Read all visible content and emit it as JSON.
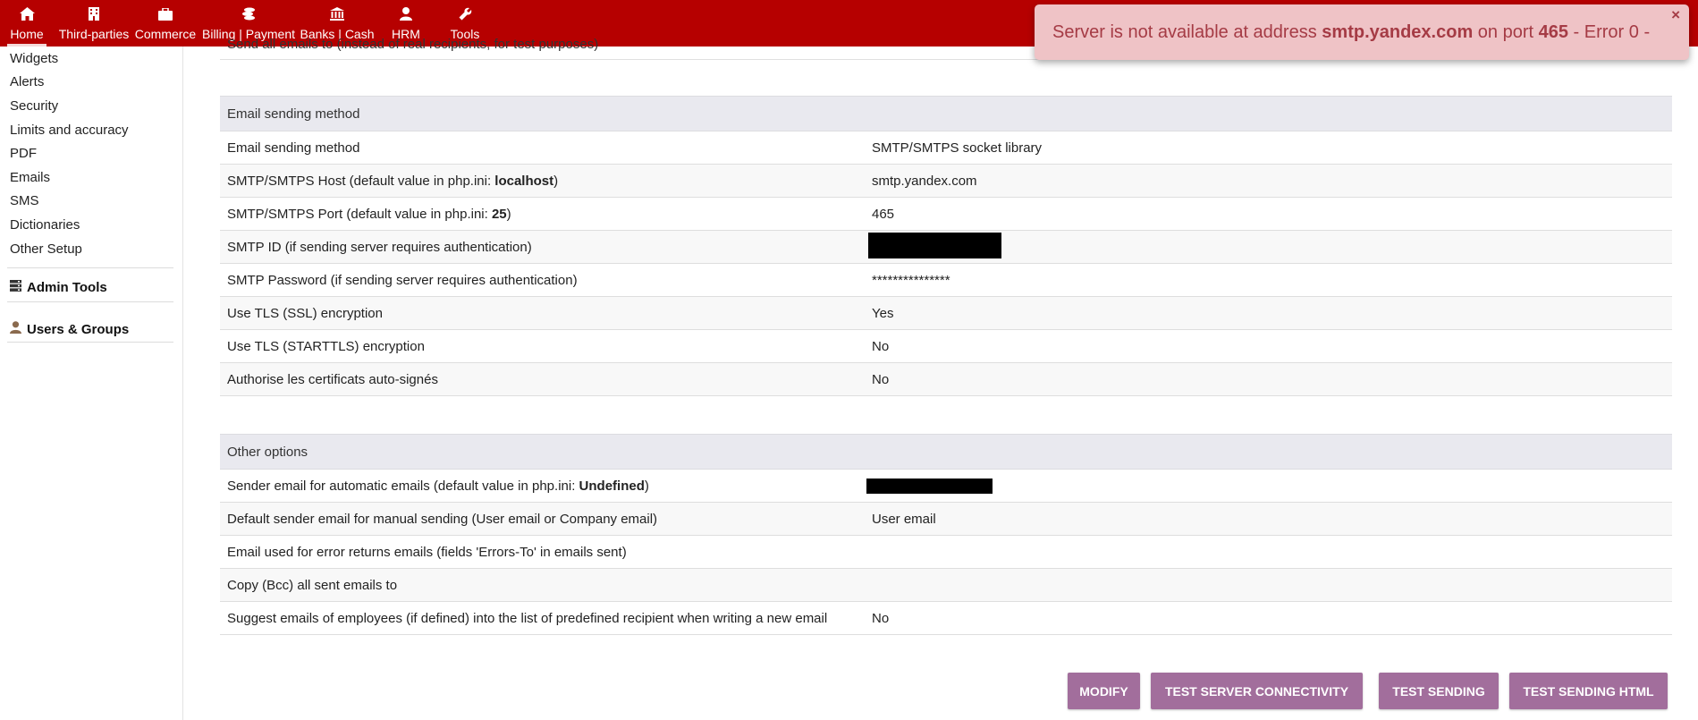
{
  "topnav": {
    "items": [
      {
        "label": "Home",
        "icon": "home-icon"
      },
      {
        "label": "Third-parties",
        "icon": "building-icon"
      },
      {
        "label": "Commerce",
        "icon": "briefcase-icon"
      },
      {
        "label": "Billing | Payment",
        "icon": "coins-icon"
      },
      {
        "label": "Banks | Cash",
        "icon": "bank-icon"
      },
      {
        "label": "HRM",
        "icon": "user-icon"
      },
      {
        "label": "Tools",
        "icon": "wrench-icon"
      }
    ],
    "bar_color": "#b60000"
  },
  "sidebar": {
    "items": [
      "Widgets",
      "Alerts",
      "Security",
      "Limits and accuracy",
      "PDF",
      "Emails",
      "SMS",
      "Dictionaries",
      "Other Setup"
    ],
    "groups": [
      {
        "label": "Admin Tools",
        "icon": "server-icon"
      },
      {
        "label": "Users & Groups",
        "icon": "user-icon"
      }
    ]
  },
  "clipped_row_text": "Send all emails to (instead of real recipients, for test purposes)",
  "sending_method": {
    "title": "Email sending method",
    "rows": [
      {
        "key": "Email sending method",
        "value": "SMTP/SMTPS socket library"
      },
      {
        "key_prefix": "SMTP/SMTPS Host (default value in php.ini: ",
        "key_bold": "localhost",
        "key_suffix": ")",
        "value": "smtp.yandex.com"
      },
      {
        "key_prefix": "SMTP/SMTPS Port (default value in php.ini: ",
        "key_bold": "25",
        "key_suffix": ")",
        "value": "465"
      },
      {
        "key": "SMTP ID (if sending server requires authentication)",
        "value": ""
      },
      {
        "key": "SMTP Password (if sending server requires authentication)",
        "value": "***************"
      },
      {
        "key": "Use TLS (SSL) encryption",
        "value": "Yes"
      },
      {
        "key": "Use TLS (STARTTLS) encryption",
        "value": "No"
      },
      {
        "key": "Authorise les certificats auto-signés",
        "value": "No"
      }
    ]
  },
  "other_options": {
    "title": "Other options",
    "rows": [
      {
        "key_prefix": "Sender email for automatic emails (default value in php.ini: ",
        "key_bold": "Undefined",
        "key_suffix": ")",
        "value": ""
      },
      {
        "key": "Default sender email for manual sending (User email or Company email)",
        "value": "User email"
      },
      {
        "key": "Email used for error returns emails (fields 'Errors-To' in emails sent)",
        "value": ""
      },
      {
        "key": "Copy (Bcc) all sent emails to",
        "value": ""
      },
      {
        "key": "Suggest emails of employees (if defined) into the list of predefined recipient when writing a new email",
        "value": "No"
      }
    ]
  },
  "buttons": {
    "modify": "MODIFY",
    "test_connectivity": "TEST SERVER CONNECTIVITY",
    "test_sending": "TEST SENDING",
    "test_sending_html": "TEST SENDING HTML"
  },
  "toast": {
    "part1": "Server is not available at address ",
    "host": "smtp.yandex.com",
    "part2": " on port ",
    "port": "465",
    "part3": " - Error 0 -",
    "close": "×"
  }
}
